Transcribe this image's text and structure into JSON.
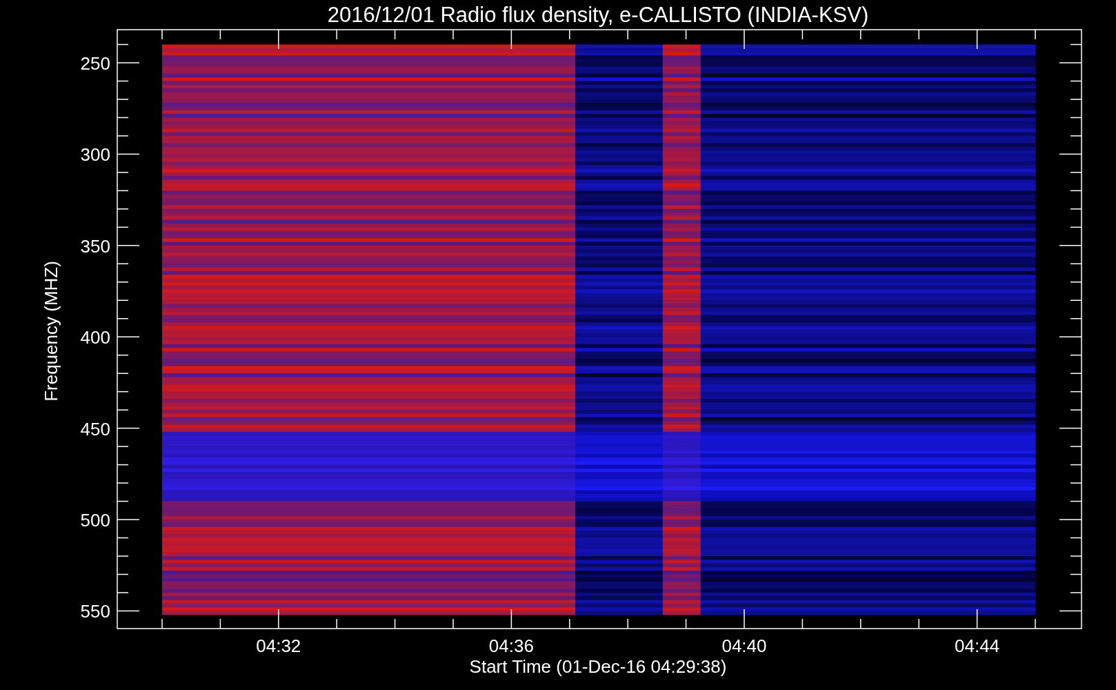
{
  "title": "2016/12/01  Radio flux density, e-CALLISTO (INDIA-KSV)",
  "y_axis": {
    "label": "Frequency (MHZ)",
    "ticks": [
      "250",
      "300",
      "350",
      "400",
      "450",
      "500",
      "550"
    ]
  },
  "x_axis": {
    "label": "Start Time (01-Dec-16 04:29:38)",
    "ticks": [
      "04:32",
      "04:36",
      "04:40",
      "04:44"
    ]
  }
}
